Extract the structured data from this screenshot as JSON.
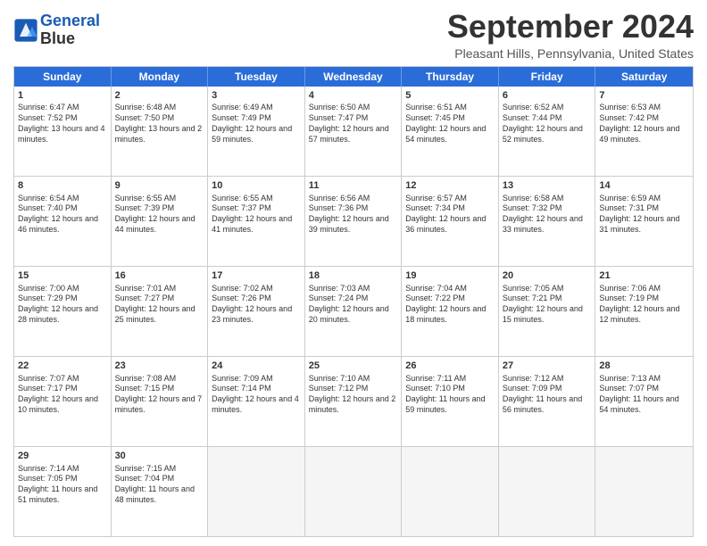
{
  "header": {
    "logo_line1": "General",
    "logo_line2": "Blue",
    "month": "September 2024",
    "location": "Pleasant Hills, Pennsylvania, United States"
  },
  "days_of_week": [
    "Sunday",
    "Monday",
    "Tuesday",
    "Wednesday",
    "Thursday",
    "Friday",
    "Saturday"
  ],
  "weeks": [
    [
      {
        "day": 1,
        "rise": "6:47 AM",
        "set": "7:52 PM",
        "daylight": "13 hours and 4 minutes."
      },
      {
        "day": 2,
        "rise": "6:48 AM",
        "set": "7:50 PM",
        "daylight": "13 hours and 2 minutes."
      },
      {
        "day": 3,
        "rise": "6:49 AM",
        "set": "7:49 PM",
        "daylight": "12 hours and 59 minutes."
      },
      {
        "day": 4,
        "rise": "6:50 AM",
        "set": "7:47 PM",
        "daylight": "12 hours and 57 minutes."
      },
      {
        "day": 5,
        "rise": "6:51 AM",
        "set": "7:45 PM",
        "daylight": "12 hours and 54 minutes."
      },
      {
        "day": 6,
        "rise": "6:52 AM",
        "set": "7:44 PM",
        "daylight": "12 hours and 52 minutes."
      },
      {
        "day": 7,
        "rise": "6:53 AM",
        "set": "7:42 PM",
        "daylight": "12 hours and 49 minutes."
      }
    ],
    [
      {
        "day": 8,
        "rise": "6:54 AM",
        "set": "7:40 PM",
        "daylight": "12 hours and 46 minutes."
      },
      {
        "day": 9,
        "rise": "6:55 AM",
        "set": "7:39 PM",
        "daylight": "12 hours and 44 minutes."
      },
      {
        "day": 10,
        "rise": "6:55 AM",
        "set": "7:37 PM",
        "daylight": "12 hours and 41 minutes."
      },
      {
        "day": 11,
        "rise": "6:56 AM",
        "set": "7:36 PM",
        "daylight": "12 hours and 39 minutes."
      },
      {
        "day": 12,
        "rise": "6:57 AM",
        "set": "7:34 PM",
        "daylight": "12 hours and 36 minutes."
      },
      {
        "day": 13,
        "rise": "6:58 AM",
        "set": "7:32 PM",
        "daylight": "12 hours and 33 minutes."
      },
      {
        "day": 14,
        "rise": "6:59 AM",
        "set": "7:31 PM",
        "daylight": "12 hours and 31 minutes."
      }
    ],
    [
      {
        "day": 15,
        "rise": "7:00 AM",
        "set": "7:29 PM",
        "daylight": "12 hours and 28 minutes."
      },
      {
        "day": 16,
        "rise": "7:01 AM",
        "set": "7:27 PM",
        "daylight": "12 hours and 25 minutes."
      },
      {
        "day": 17,
        "rise": "7:02 AM",
        "set": "7:26 PM",
        "daylight": "12 hours and 23 minutes."
      },
      {
        "day": 18,
        "rise": "7:03 AM",
        "set": "7:24 PM",
        "daylight": "12 hours and 20 minutes."
      },
      {
        "day": 19,
        "rise": "7:04 AM",
        "set": "7:22 PM",
        "daylight": "12 hours and 18 minutes."
      },
      {
        "day": 20,
        "rise": "7:05 AM",
        "set": "7:21 PM",
        "daylight": "12 hours and 15 minutes."
      },
      {
        "day": 21,
        "rise": "7:06 AM",
        "set": "7:19 PM",
        "daylight": "12 hours and 12 minutes."
      }
    ],
    [
      {
        "day": 22,
        "rise": "7:07 AM",
        "set": "7:17 PM",
        "daylight": "12 hours and 10 minutes."
      },
      {
        "day": 23,
        "rise": "7:08 AM",
        "set": "7:15 PM",
        "daylight": "12 hours and 7 minutes."
      },
      {
        "day": 24,
        "rise": "7:09 AM",
        "set": "7:14 PM",
        "daylight": "12 hours and 4 minutes."
      },
      {
        "day": 25,
        "rise": "7:10 AM",
        "set": "7:12 PM",
        "daylight": "12 hours and 2 minutes."
      },
      {
        "day": 26,
        "rise": "7:11 AM",
        "set": "7:10 PM",
        "daylight": "11 hours and 59 minutes."
      },
      {
        "day": 27,
        "rise": "7:12 AM",
        "set": "7:09 PM",
        "daylight": "11 hours and 56 minutes."
      },
      {
        "day": 28,
        "rise": "7:13 AM",
        "set": "7:07 PM",
        "daylight": "11 hours and 54 minutes."
      }
    ],
    [
      {
        "day": 29,
        "rise": "7:14 AM",
        "set": "7:05 PM",
        "daylight": "11 hours and 51 minutes."
      },
      {
        "day": 30,
        "rise": "7:15 AM",
        "set": "7:04 PM",
        "daylight": "11 hours and 48 minutes."
      },
      null,
      null,
      null,
      null,
      null
    ]
  ]
}
